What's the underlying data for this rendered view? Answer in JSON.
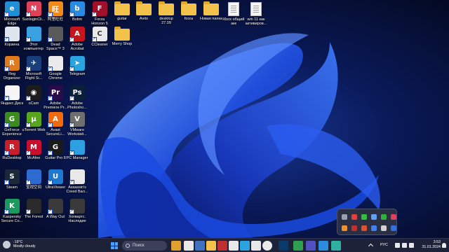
{
  "desktop": {
    "icons": [
      {
        "label": "Microsoft\nEdge",
        "color": "#1f8fd6",
        "glyph": "e",
        "icon": "edge-icon"
      },
      {
        "label": "Корзина",
        "color": "#dfe6ee",
        "glyph": "",
        "icon": "recycle-bin-icon"
      },
      {
        "label": "Reg\nOrganizer",
        "color": "#e07a1b",
        "glyph": "R",
        "icon": "reg-organizer-icon"
      },
      {
        "label": "Яндекс.Диск",
        "color": "#f5f5f5",
        "glyph": "",
        "icon": "yandex-disk-icon"
      },
      {
        "label": "GeForce\nExperience",
        "color": "#3d8b1e",
        "glyph": "G",
        "icon": "geforce-icon"
      },
      {
        "label": "RuDesktop",
        "color": "#c81e2a",
        "glyph": "R",
        "icon": "rudesktop-icon"
      },
      {
        "label": "Steam",
        "color": "#1b2838",
        "glyph": "S",
        "icon": "steam-icon"
      },
      {
        "label": "Kaspersky\nSecure Co...",
        "color": "#1a9a5c",
        "glyph": "K",
        "icon": "kaspersky-icon"
      },
      {
        "label": "SunloginCli...",
        "color": "#e0405a",
        "glyph": "N",
        "icon": "sunlogin-icon"
      },
      {
        "label": "Этот\nкомпьютер",
        "color": "#3aa0e0",
        "glyph": "",
        "icon": "this-pc-icon"
      },
      {
        "label": "Microsoft\nFlight Si...",
        "color": "#1a3e7a",
        "glyph": "✈",
        "icon": "flight-sim-icon"
      },
      {
        "label": "oCam",
        "color": "#1c1c1c",
        "glyph": "◉",
        "icon": "ocam-icon"
      },
      {
        "label": "uTorrent Web",
        "color": "#5aa51e",
        "glyph": "μ",
        "icon": "utorrent-icon"
      },
      {
        "label": "McAfee",
        "color": "#c8102e",
        "glyph": "M",
        "icon": "mcafee-icon"
      },
      {
        "label": "宝视空间",
        "color": "#2e6bd0",
        "glyph": "",
        "icon": "app-icon"
      },
      {
        "label": "The Forest",
        "color": "#2a2a2a",
        "glyph": "",
        "icon": "the-forest-icon"
      },
      {
        "label": "阿里旺旺",
        "color": "#f08a1a",
        "glyph": "旺",
        "icon": "aliwangwang-icon"
      },
      {
        "label": "Dead\nSpace™ 3",
        "color": "#5a5a5a",
        "glyph": "",
        "icon": "dead-space-icon"
      },
      {
        "label": "Google\nChrome",
        "color": "#eaeaea",
        "glyph": "",
        "icon": "chrome-icon"
      },
      {
        "label": "Adobe\nPremiere Pr...",
        "color": "#2a0a4a",
        "glyph": "Pr",
        "icon": "premiere-icon"
      },
      {
        "label": "Avast\nSecureLi...",
        "color": "#f06a10",
        "glyph": "A",
        "icon": "avast-icon"
      },
      {
        "label": "Guitar Pro 8",
        "color": "#1a1a1a",
        "glyph": "G",
        "icon": "guitar-pro-icon"
      },
      {
        "label": "UltraViewer",
        "color": "#1e78d0",
        "glyph": "U",
        "icon": "ultraviewer-icon"
      },
      {
        "label": "A Way Out",
        "color": "#3a3a3a",
        "glyph": "",
        "icon": "a-way-out-icon"
      },
      {
        "label": "Botim",
        "color": "#2a8be0",
        "glyph": "b",
        "icon": "botim-icon"
      },
      {
        "label": "Adobe\nAcrobat",
        "color": "#c4161c",
        "glyph": "A",
        "icon": "acrobat-icon"
      },
      {
        "label": "Telegram",
        "color": "#2aa3df",
        "glyph": "➤",
        "icon": "telegram-icon"
      },
      {
        "label": "Adobe\nPhotosho...",
        "color": "#0a1f3a",
        "glyph": "Ps",
        "icon": "photoshop-icon"
      },
      {
        "label": "VMware\nWorkstati...",
        "color": "#6f6f6f",
        "glyph": "V",
        "icon": "vmware-icon"
      },
      {
        "label": "PC Manager",
        "color": "#2e9fe0",
        "glyph": "",
        "icon": "pc-manager-icon"
      },
      {
        "label": "Assassin's\nCreed Вал...",
        "color": "#e8e8e8",
        "glyph": "",
        "icon": "assassins-creed-icon"
      },
      {
        "label": "Хогвартс.\nНаследие",
        "color": "#3a3a3a",
        "glyph": "",
        "icon": "hogwarts-legacy-icon"
      },
      {
        "label": "Forza\nHorizon 5",
        "color": "#a0102a",
        "glyph": "F",
        "icon": "forza-icon"
      },
      {
        "label": "CCleaner",
        "color": "#eaeaea",
        "glyph": "C",
        "icon": "ccleaner-icon"
      },
      {
        "label": "guitar",
        "color": "#f2c24a",
        "glyph": "",
        "icon": "folder-icon"
      },
      {
        "label": "Merry Shop",
        "color": "#f2c24a",
        "glyph": "",
        "icon": "folder-icon"
      },
      {
        "label": "Avito",
        "color": "#f2c24a",
        "glyph": "",
        "icon": "folder-icon"
      },
      {
        "label": "desktop\n27.09",
        "color": "#f2c24a",
        "glyph": "",
        "icon": "folder-icon"
      },
      {
        "label": "forza",
        "color": "#f2c24a",
        "glyph": "",
        "icon": "folder-icon"
      },
      {
        "label": "Новая папка",
        "color": "#f2c24a",
        "glyph": "",
        "icon": "folder-icon"
      },
      {
        "label": "Xbox общий\nакк",
        "color": "#ffffff",
        "glyph": "",
        "icon": "text-file-icon"
      },
      {
        "label": "win 11 как\nактивиров...",
        "color": "#ffffff",
        "glyph": "",
        "icon": "text-file-icon"
      }
    ]
  },
  "taskbar": {
    "weather_temp": "-19°C",
    "weather_desc": "Mostly cloudy",
    "search_placeholder": "Поиск",
    "language": "РУС",
    "time": "3:53",
    "date": "31.01.2024",
    "pinned": [
      {
        "icon": "start-icon",
        "color": "#3d8fe8"
      },
      {
        "icon": "app-icon",
        "color": "#e0a030"
      },
      {
        "icon": "app-icon",
        "color": "#e8e8e8"
      },
      {
        "icon": "app-icon",
        "color": "#4070c0"
      },
      {
        "icon": "file-explorer-icon",
        "color": "#f2c24a"
      },
      {
        "icon": "app-icon",
        "color": "#c03030"
      },
      {
        "icon": "app-icon",
        "color": "#e8e8e8"
      },
      {
        "icon": "app-icon",
        "color": "#2aa3df"
      },
      {
        "icon": "app-icon",
        "color": "#e8e8e8"
      },
      {
        "icon": "chrome-icon",
        "color": "#eaeaea"
      },
      {
        "icon": "photoshop-icon",
        "color": "#0a3a6a"
      },
      {
        "icon": "app-icon",
        "color": "#30a050"
      },
      {
        "icon": "app-icon",
        "color": "#5050c0"
      },
      {
        "icon": "app-icon",
        "color": "#2a8be0"
      },
      {
        "icon": "app-icon",
        "color": "#30b0a0"
      }
    ]
  },
  "tray_popup": {
    "icons": [
      {
        "icon": "tray-app-icon",
        "color": "#9aa0b0"
      },
      {
        "icon": "tray-app-icon",
        "color": "#e04040"
      },
      {
        "icon": "tray-app-icon",
        "color": "#30c040"
      },
      {
        "icon": "tray-app-icon",
        "color": "#60a0f0"
      },
      {
        "icon": "tray-app-icon",
        "color": "#30b040"
      },
      {
        "icon": "tray-app-icon",
        "color": "#e04060"
      },
      {
        "icon": "tray-app-icon",
        "color": "#f09030"
      },
      {
        "icon": "tray-app-icon",
        "color": "#c03030"
      },
      {
        "icon": "tray-app-icon",
        "color": "#e05030"
      },
      {
        "icon": "tray-app-icon",
        "color": "#4080f0"
      },
      {
        "icon": "tray-app-icon",
        "color": "#d0d0d0"
      },
      {
        "icon": "bluetooth-icon",
        "color": "#3070e0"
      }
    ]
  }
}
